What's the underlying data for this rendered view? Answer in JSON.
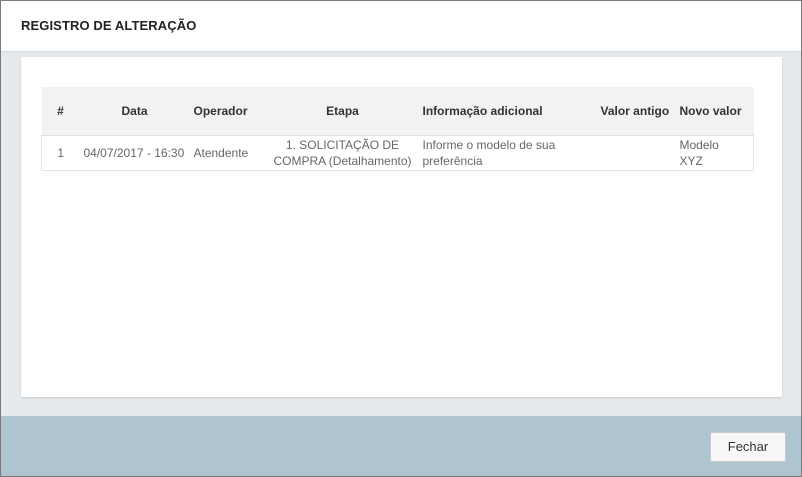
{
  "modal": {
    "title": "REGISTRO DE ALTERAÇÃO"
  },
  "table": {
    "headers": {
      "num": "#",
      "data": "Data",
      "operador": "Operador",
      "etapa": "Etapa",
      "informacao": "Informação adicional",
      "valor_antigo": "Valor antigo",
      "novo_valor": "Novo valor"
    },
    "rows": [
      {
        "num": "1",
        "data": "04/07/2017 - 16:30",
        "operador": "Atendente",
        "etapa_line1": "1. SOLICITAÇÃO DE",
        "etapa_line2": "COMPRA (Detalhamento)",
        "informacao_line1": "Informe o modelo de sua",
        "informacao_line2": "preferência",
        "valor_antigo": "",
        "novo_valor_line1": "Modelo",
        "novo_valor_line2": "XYZ"
      }
    ]
  },
  "footer": {
    "close_label": "Fechar"
  },
  "colors": {
    "footer_bg": "#aec4cf",
    "body_bg": "#e6eaec",
    "header_row_bg": "#f2f2f2"
  }
}
